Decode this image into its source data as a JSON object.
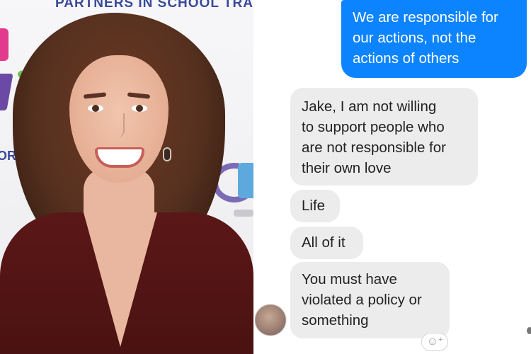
{
  "photo": {
    "backdrop_text": "PARTNERS IN SCHOOL TRA",
    "backdrop_fragment": "ORM"
  },
  "chat": {
    "messages": [
      {
        "direction": "outgoing",
        "text": "We are responsible for\nour actions, not the\nactions of others"
      },
      {
        "direction": "incoming",
        "text": "Jake, I am not willing\nto support people who\nare not responsible for\ntheir own love"
      },
      {
        "direction": "incoming",
        "text": "Life"
      },
      {
        "direction": "incoming",
        "text": "All of it"
      },
      {
        "direction": "incoming",
        "text": "You must have\nviolated a policy or\nsomething"
      }
    ],
    "react_icon": "add-reaction-icon"
  },
  "colors": {
    "outgoing_bubble": "#0d84ff",
    "incoming_bubble": "#ececec",
    "dress": "#5b1717"
  }
}
